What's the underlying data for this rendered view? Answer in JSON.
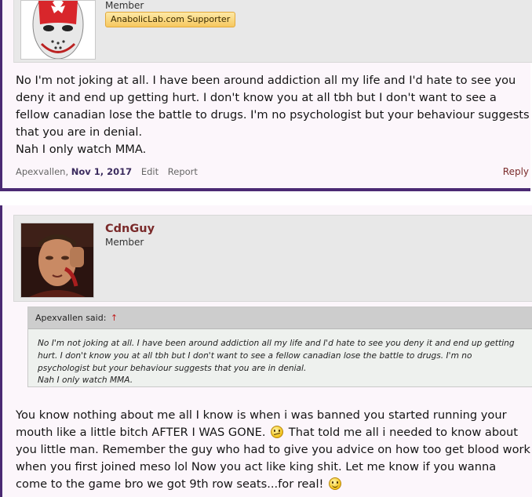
{
  "post1": {
    "user_role": "Member",
    "badge": "AnabolicLab.com Supporter",
    "body_paragraphs": [
      "No I'm not joking at all. I have been around addiction all my life and I'd hate to see you deny it and end up getting hurt. I don't know you at all tbh but I don't want to see a fellow canadian lose the battle to drugs. I'm no psychologist but your behaviour suggests that you are in denial.",
      "Nah I only watch MMA."
    ],
    "author": "Apexvallen",
    "date": "Nov 1, 2017",
    "edit_label": "Edit",
    "report_label": "Report",
    "reply_label": "Reply"
  },
  "post2": {
    "username": "CdnGuy",
    "user_role": "Member",
    "quote": {
      "attribution": "Apexvallen said:",
      "arrow": "↑",
      "paragraphs": [
        "No I'm not joking at all. I have been around addiction all my life and I'd hate to see you deny it and end up getting hurt. I don't know you at all tbh but I don't want to see a fellow canadian lose the battle to drugs. I'm no psychologist but your behaviour suggests that you are in denial.",
        "Nah I only watch MMA."
      ]
    },
    "body_part1": "You know nothing about me all I know is when i was banned you started running your mouth like a little bitch AFTER I WAS GONE.",
    "body_part2": "That told me all i needed to know about you little man. Remember the guy who had to give you advice on how too get blood work when you first joined meso lol Now you act like king shit. Let me know if you wanna come to the game bro we got 9th row seats...for real!",
    "smilies": [
      "confused-smiley-icon",
      "smile-smiley-icon"
    ]
  }
}
